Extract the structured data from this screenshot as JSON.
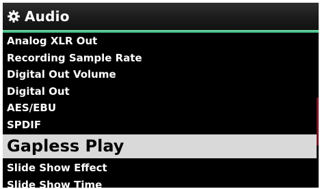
{
  "header": {
    "title": "Audio",
    "icon": "gear-icon",
    "accent_color": "#2fae72"
  },
  "menu": {
    "items": [
      {
        "label": "Analog XLR Out",
        "selected": false
      },
      {
        "label": "Recording Sample Rate",
        "selected": false
      },
      {
        "label": "Digital Out Volume",
        "selected": false
      },
      {
        "label": "Digital Out",
        "selected": false
      },
      {
        "label": "AES/EBU",
        "selected": false
      },
      {
        "label": "SPDIF",
        "selected": false
      },
      {
        "label": "Gapless Play",
        "selected": true
      },
      {
        "label": "Slide Show Effect",
        "selected": false
      },
      {
        "label": "Slide Show Time",
        "selected": false
      }
    ],
    "selected_bg": "#d9d9d9"
  }
}
